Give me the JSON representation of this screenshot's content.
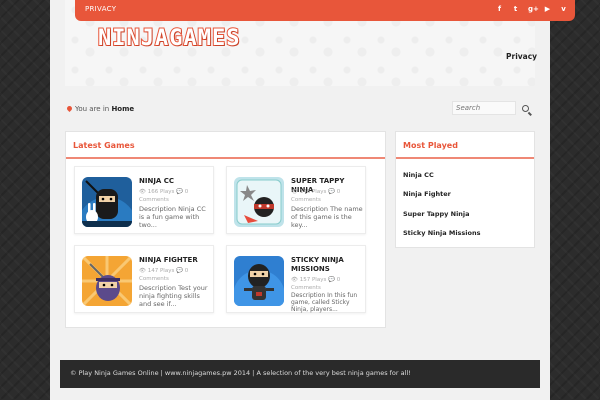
{
  "topbar": {
    "link": "PRIVACY",
    "social": [
      "f",
      "t",
      "g+",
      "▶",
      "v"
    ]
  },
  "logo": "NINJAGAMES",
  "nav": {
    "privacy": "Privacy"
  },
  "breadcrumb": {
    "prefix": "You are in",
    "current": "Home"
  },
  "search": {
    "placeholder": "Search"
  },
  "latest": {
    "title": "Latest Games",
    "games": [
      {
        "title": "NINJA CC",
        "plays": "166 Plays",
        "comments": "0",
        "comments_label": "Comments",
        "desc": "Description Ninja CC is a fun game with two..."
      },
      {
        "title": "SUPER TAPPY NINJA",
        "plays": "146 Plays",
        "comments": "0",
        "comments_label": "Comments",
        "desc": "Description The name of this game is the key..."
      },
      {
        "title": "NINJA FIGHTER",
        "plays": "147 Plays",
        "comments": "0",
        "comments_label": "Comments",
        "desc": "Description Test your ninja fighting skills and see if..."
      },
      {
        "title": "STICKY NINJA MISSIONS",
        "plays": "157 Plays",
        "comments": "0",
        "comments_label": "Comments",
        "desc": "Description In this fun game, called Sticky Ninja, players..."
      }
    ]
  },
  "most_played": {
    "title": "Most Played",
    "items": [
      "Ninja CC",
      "Ninja Fighter",
      "Super Tappy Ninja",
      "Sticky Ninja Missions"
    ]
  },
  "footer": {
    "text": "© Play Ninja Games Online | www.ninjagames.pw 2014 | A selection of the very best ninja games for all!"
  },
  "colors": {
    "accent": "#e8563a",
    "background": "#2b2b2b"
  }
}
